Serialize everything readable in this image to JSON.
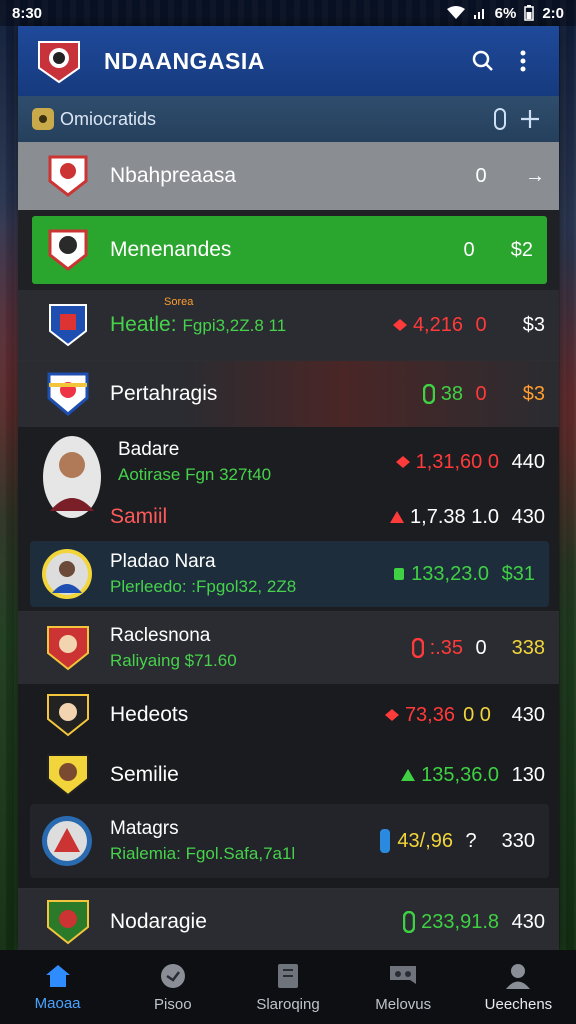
{
  "status_bar": {
    "time": "8:30",
    "signal_text": "6%",
    "clock_right": "2:0"
  },
  "app_bar": {
    "title": "NDAANGASIA"
  },
  "sub_bar": {
    "label": "Omiocratids"
  },
  "rows": [
    {
      "name": "Nbahpreaasa",
      "odd": "0",
      "last": "→",
      "bg": "#8a8d92"
    },
    {
      "name": "Menenandes",
      "odd": "0",
      "last": "$2",
      "bg": "#2aa52d"
    },
    {
      "tag": "Sorea",
      "name": "Heatle:",
      "sub": "Fgpi3,2Z.8 11",
      "value": "4,216",
      "odd": "0",
      "last": "$3"
    },
    {
      "name": "Pertahragis",
      "value": "38",
      "odd": "0",
      "last": "$3"
    },
    {
      "name": "Badare",
      "sub": "Aotirase Fgn 327t40",
      "value": "1,31,60 0",
      "last": "440"
    },
    {
      "name": "Samiil",
      "value": "1,7.38 1.0",
      "last": "430"
    },
    {
      "name": "Pladao Nara",
      "sub": "Plerleedo: :Fpgol32, 2Z8",
      "value": "133,23.0",
      "last": "$31"
    },
    {
      "name": "Raclesnona",
      "sub": "Raliyaing $71.60",
      "value": ":.35",
      "odd": "0",
      "last": "338"
    },
    {
      "name": "Hedeots",
      "value": "73,36",
      "odd": "0 0",
      "last": "430"
    },
    {
      "name": "Semilie",
      "value": "135,36.0",
      "last": "130"
    },
    {
      "name": "Matagrs",
      "sub": "Rialemia: Fgol.Safa,7a1l",
      "value": "43/,96",
      "odd": "?",
      "last": "330"
    },
    {
      "name": "Nodaragie",
      "value": "233,91.8",
      "last": "430"
    }
  ],
  "nav": [
    {
      "label": "Maoaa",
      "icon": "home-icon"
    },
    {
      "label": "Pisoo",
      "icon": "ball-icon"
    },
    {
      "label": "Slaroqing",
      "icon": "standings-icon"
    },
    {
      "label": "Melovus",
      "icon": "stats-icon"
    },
    {
      "label": "Ueechens",
      "icon": "user-icon"
    }
  ]
}
